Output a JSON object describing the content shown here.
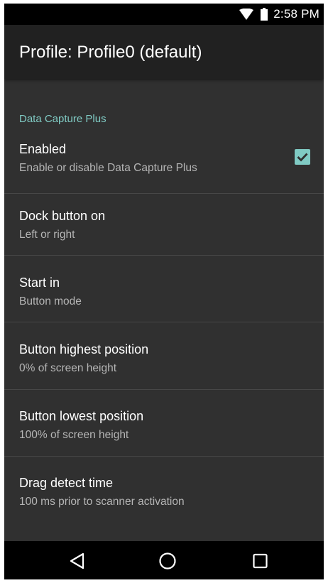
{
  "status_bar": {
    "time": "2:58 PM",
    "icons": [
      "wifi-icon",
      "battery-icon"
    ]
  },
  "app_bar": {
    "title": "Profile: Profile0 (default)"
  },
  "section": {
    "category": "Data Capture Plus"
  },
  "preferences": [
    {
      "title": "Enabled",
      "summary": "Enable or disable Data Capture Plus",
      "checked": true
    },
    {
      "title": "Dock button on",
      "summary": "Left or right"
    },
    {
      "title": "Start in",
      "summary": "Button mode"
    },
    {
      "title": "Button highest position",
      "summary": "0% of screen height"
    },
    {
      "title": "Button lowest position",
      "summary": "100% of screen height"
    },
    {
      "title": "Drag detect time",
      "summary": "100 ms prior to scanner activation"
    }
  ],
  "nav_bar": {
    "icons": [
      "back-icon",
      "home-icon",
      "recents-icon"
    ]
  },
  "colors": {
    "accent": "#80cbc4",
    "background": "#303030",
    "app_bar": "#212121"
  }
}
